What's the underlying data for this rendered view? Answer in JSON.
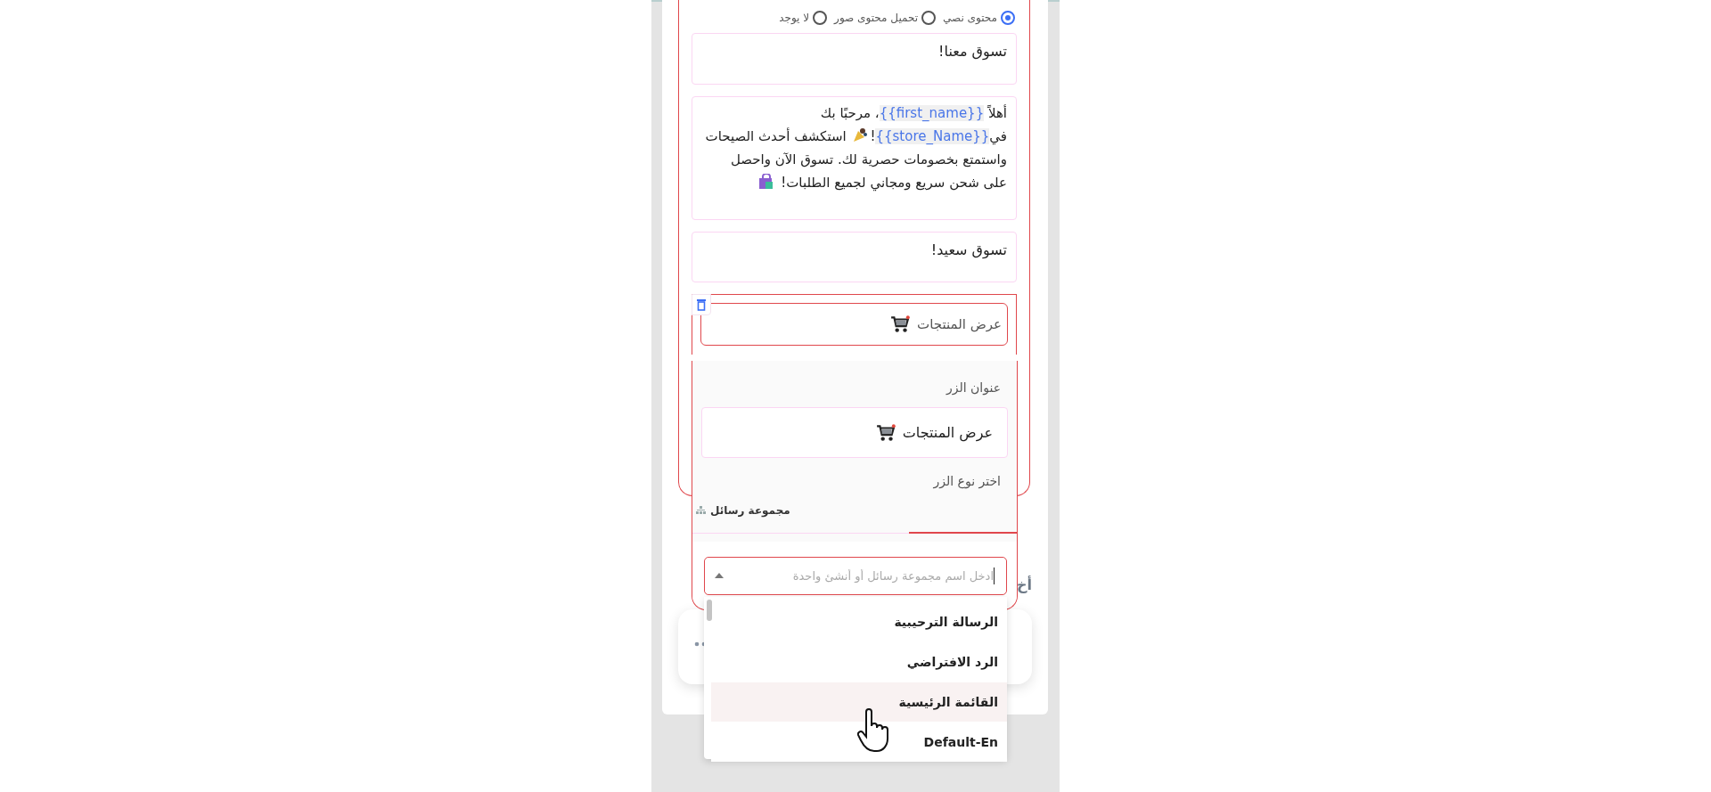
{
  "content_type": {
    "options": [
      {
        "label": "محتوى نصي",
        "selected": true
      },
      {
        "label": "تحميل محتوى صور",
        "selected": false
      },
      {
        "label": "لا يوجد",
        "selected": false
      }
    ]
  },
  "header_text": "تسوق معنا!",
  "body_lines": [
    [
      {
        "kind": "text",
        "text": "أهلاً "
      },
      {
        "kind": "variable",
        "text": "{{first_name}}"
      },
      {
        "kind": "text",
        "text": "، مرحبًا بك"
      }
    ],
    [
      {
        "kind": "text",
        "text": "في"
      },
      {
        "kind": "variable",
        "text": "{{store_Name}}"
      },
      {
        "kind": "text",
        "text": "!"
      },
      {
        "kind": "party_icon"
      },
      {
        "kind": "text",
        "text": " استكشف أحدث الصيحات"
      }
    ],
    [
      {
        "kind": "text",
        "text": "واستمتع بخصومات حصرية لك. تسوق الآن واحصل"
      }
    ],
    [
      {
        "kind": "text",
        "text": "على شحن سريع ومجاني لجميع الطلبات! "
      },
      {
        "kind": "bag_icon"
      }
    ]
  ],
  "footer_text": "تسوق سعيد!",
  "button_preview": {
    "label": "عرض المنتجات"
  },
  "button_editor": {
    "title_label": "عنوان الزر",
    "title_value": "عرض المنتجات",
    "type_label": "اختر نوع الزر",
    "tabs": [
      {
        "label": "مجموعة رسائل",
        "selected": false
      }
    ],
    "group_select": {
      "placeholder": "ادخل اسم مجموعة رسائل أو أنشئ واحدة"
    },
    "options": [
      {
        "label": "الرسالة الترحيبية",
        "selected": false
      },
      {
        "label": "الرد الافتراضي",
        "selected": false
      },
      {
        "label": "القائمة الرئيسية",
        "selected": true
      },
      {
        "label": "Default-En",
        "selected": false
      }
    ]
  },
  "section_label": "أخ"
}
